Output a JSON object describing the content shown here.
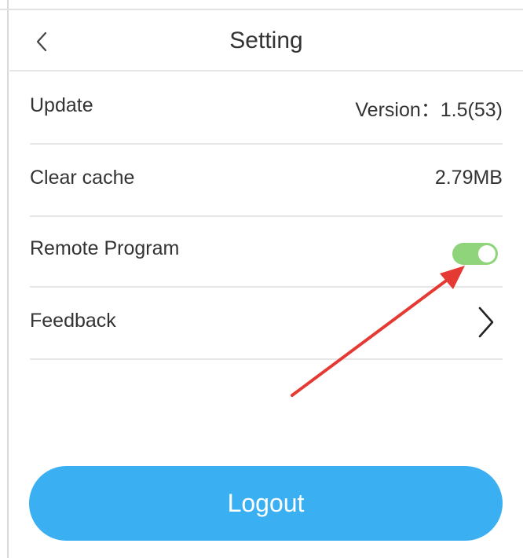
{
  "header": {
    "title": "Setting",
    "back_icon": "chevron-left-icon"
  },
  "rows": [
    {
      "label": "Update",
      "value": "Version：1.5(53)"
    },
    {
      "label": "Clear cache",
      "value": "2.79MB"
    },
    {
      "label": "Remote Program",
      "toggle_on": true,
      "toggle_color": "#8fd47a"
    },
    {
      "label": "Feedback",
      "icon": "chevron-right-icon"
    }
  ],
  "annotation": {
    "type": "arrow",
    "color": "#e53a33",
    "points_to": "remote-program-toggle"
  },
  "logout": {
    "label": "Logout",
    "color": "#3ab0f3"
  }
}
